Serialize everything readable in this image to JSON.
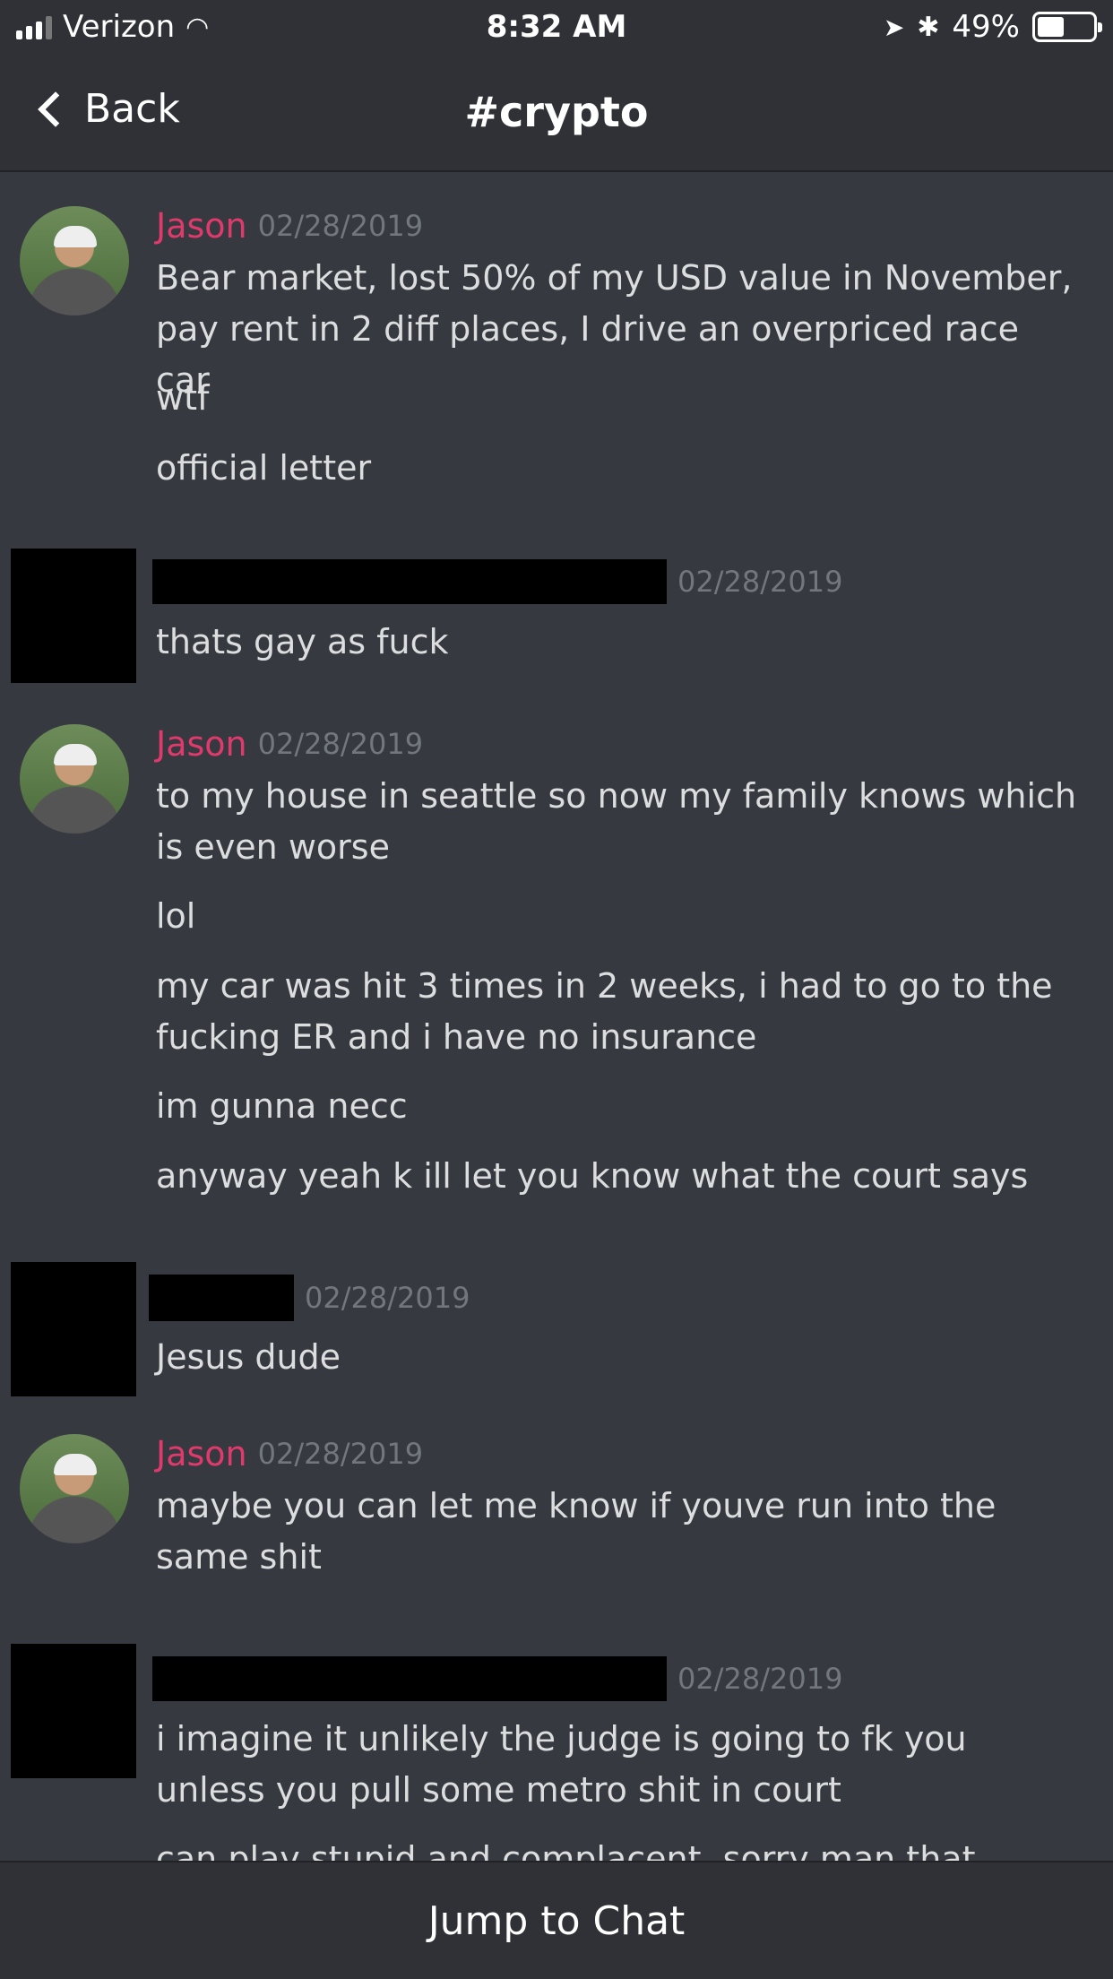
{
  "status_bar": {
    "carrier": "Verizon",
    "time": "8:32 AM",
    "battery": "49%"
  },
  "nav": {
    "back_label": "Back",
    "title": "#crypto"
  },
  "messages": [
    {
      "author": "Jason",
      "timestamp": "02/28/2019",
      "lines": [
        "Bear market, lost 50% of my USD value in November, pay rent in 2 diff places, I drive an overpriced race car",
        "wtf",
        "official letter"
      ]
    },
    {
      "author": "",
      "timestamp": "02/28/2019",
      "lines": [
        "thats gay as fuck"
      ]
    },
    {
      "author": "Jason",
      "timestamp": "02/28/2019",
      "lines": [
        "to my house in seattle so now my family knows which is even worse",
        "lol",
        "my car was hit 3 times in 2 weeks, i had to go to the fucking ER and i have no insurance",
        "im gunna necc",
        "anyway yeah k ill let you know what the court says"
      ]
    },
    {
      "author": "",
      "timestamp": "02/28/2019",
      "lines": [
        "Jesus dude"
      ]
    },
    {
      "author": "Jason",
      "timestamp": "02/28/2019",
      "lines": [
        "maybe you can let me know if youve run into the same shit"
      ]
    },
    {
      "author": "",
      "timestamp": "02/28/2019",
      "lines": [
        "i imagine it unlikely the judge is going to fk you unless you pull some metro shit in court",
        "can play stupid and complacent, sorry man that blows"
      ]
    }
  ],
  "footer": {
    "jump_label": "Jump to Chat"
  },
  "colors": {
    "background": "#36393f",
    "bar": "#2f3136",
    "username": "#e03a6d",
    "timestamp": "#72767d",
    "text": "#dcddde"
  }
}
